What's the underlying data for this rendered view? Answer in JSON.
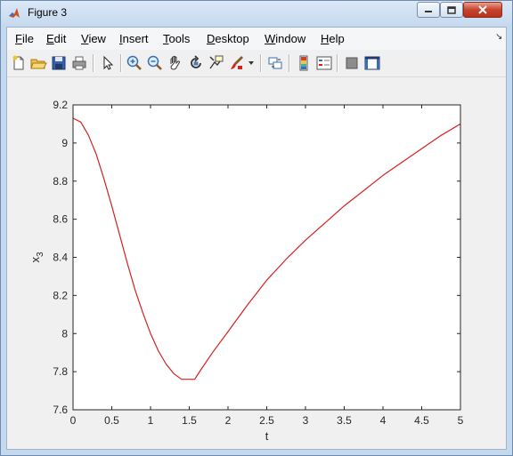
{
  "window": {
    "title": "Figure 3"
  },
  "menu": {
    "items": [
      {
        "label": "File",
        "name": "menu-file"
      },
      {
        "label": "Edit",
        "name": "menu-edit"
      },
      {
        "label": "View",
        "name": "menu-view"
      },
      {
        "label": "Insert",
        "name": "menu-insert"
      },
      {
        "label": "Tools",
        "name": "menu-tools"
      },
      {
        "label": "Desktop",
        "name": "menu-desktop"
      },
      {
        "label": "Window",
        "name": "menu-window"
      },
      {
        "label": "Help",
        "name": "menu-help"
      }
    ]
  },
  "toolbar": {
    "icons": [
      "new-figure-icon",
      "open-file-icon",
      "save-icon",
      "print-icon",
      "edit-plot-arrow-icon",
      "zoom-in-icon",
      "zoom-out-icon",
      "pan-hand-icon",
      "rotate-3d-icon",
      "data-cursor-icon",
      "brush-icon",
      "link-plot-icon",
      "colorbar-icon",
      "legend-icon",
      "hide-plot-tools-icon",
      "show-plot-tools-icon"
    ]
  },
  "chart_data": {
    "type": "line",
    "title": "",
    "xlabel": "t",
    "ylabel": "x3",
    "xlim": [
      0,
      5
    ],
    "ylim": [
      7.6,
      9.2
    ],
    "xticks": [
      "0",
      "0.5",
      "1",
      "1.5",
      "2",
      "2.5",
      "3",
      "3.5",
      "4",
      "4.5",
      "5"
    ],
    "yticks": [
      "7.6",
      "7.8",
      "8",
      "8.2",
      "8.4",
      "8.6",
      "8.8",
      "9",
      "9.2"
    ],
    "grid": false,
    "series": [
      {
        "color": "#d62020",
        "x": [
          0,
          0.1,
          0.2,
          0.3,
          0.4,
          0.5,
          0.6,
          0.7,
          0.8,
          0.9,
          1.0,
          1.1,
          1.2,
          1.3,
          1.4,
          1.5,
          1.57,
          1.65,
          1.8,
          2.0,
          2.25,
          2.5,
          2.75,
          3.0,
          3.25,
          3.5,
          3.75,
          4.0,
          4.25,
          4.5,
          4.75,
          5.0
        ],
        "y": [
          9.13,
          9.11,
          9.04,
          8.94,
          8.81,
          8.67,
          8.52,
          8.37,
          8.23,
          8.11,
          8.0,
          7.91,
          7.84,
          7.79,
          7.76,
          7.76,
          7.76,
          7.81,
          7.9,
          8.01,
          8.15,
          8.28,
          8.39,
          8.49,
          8.58,
          8.67,
          8.75,
          8.83,
          8.9,
          8.97,
          9.04,
          9.1
        ]
      }
    ]
  }
}
